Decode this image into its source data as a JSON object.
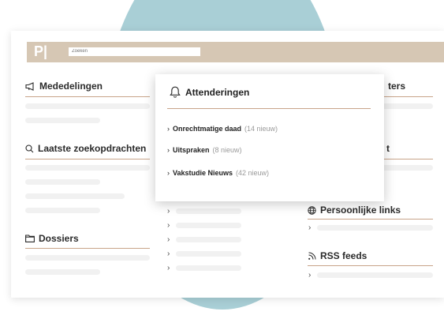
{
  "topbar": {
    "logo": "P|",
    "search_placeholder": "Zoeken"
  },
  "sections": {
    "mededelingen": "Mededelingen",
    "zoekopdrachten": "Laatste zoekopdrachten",
    "dossiers": "Dossiers",
    "letters_partial": "ters",
    "t_partial": "t",
    "persoonlijke_links": "Persoonlijke links",
    "rss_feeds": "RSS feeds"
  },
  "popup": {
    "title": "Attenderingen",
    "items": [
      {
        "name": "Onrechtmatige daad",
        "count": "(14 nieuw)"
      },
      {
        "name": "Uitspraken",
        "count": "(8 nieuw)"
      },
      {
        "name": "Vakstudie Nieuws",
        "count": "(42 nieuw)"
      }
    ]
  },
  "glyphs": {
    "chevron": "›"
  },
  "colors": {
    "accent_rule": "#c8a48a",
    "topbar": "#d6c7b4",
    "circle": "#a9cfd6"
  }
}
